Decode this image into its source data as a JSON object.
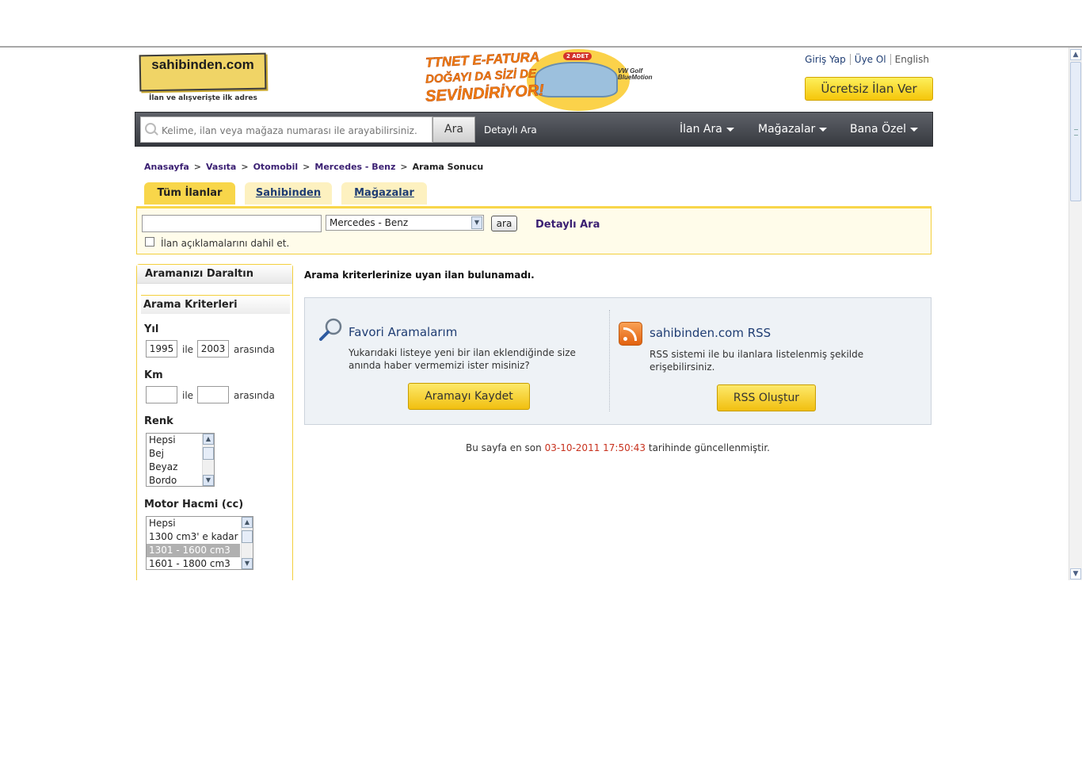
{
  "header": {
    "logo_text": "sahibinden.com",
    "logo_tagline": "İlan ve alışverişte ilk adres",
    "banner": {
      "line1": "TTNET E-FATURA",
      "line2": "DOĞAYI DA SİZİ DE",
      "line3": "SEVİNDİRİYOR!",
      "badge": "2 ADET",
      "model": "VW Golf BlueMotion"
    },
    "links": {
      "login": "Giriş Yap",
      "register": "Üye Ol",
      "english": "English"
    },
    "free_ad_button": "Ücretsiz İlan Ver"
  },
  "navbar": {
    "search_placeholder": "Kelime, ilan veya mağaza numarası ile arayabilirsiniz.",
    "search_button": "Ara",
    "detailed_search": "Detaylı Ara",
    "menus": [
      "İlan Ara",
      "Mağazalar",
      "Bana Özel"
    ]
  },
  "breadcrumb": [
    "Anasayfa",
    "Vasıta",
    "Otomobil",
    "Mercedes - Benz",
    "Arama Sonucu"
  ],
  "tabs": [
    "Tüm İlanlar",
    "Sahibinden",
    "Mağazalar"
  ],
  "filter": {
    "keyword_value": "",
    "brand_selected": "Mercedes - Benz",
    "search_button": "ara",
    "detailed_link": "Detaylı Ara",
    "include_desc_label": "İlan açıklamalarını dahil et."
  },
  "sidebar": {
    "title": "Aramanızı Daraltın",
    "criteria_title": "Arama Kriterleri",
    "year": {
      "label": "Yıl",
      "from": "1995",
      "between": "ile",
      "to": "2003",
      "suffix": "arasında"
    },
    "km": {
      "label": "Km",
      "from": "",
      "between": "ile",
      "to": "",
      "suffix": "arasında"
    },
    "color": {
      "label": "Renk",
      "options": [
        "Hepsi",
        "Bej",
        "Beyaz",
        "Bordo"
      ]
    },
    "engine": {
      "label": "Motor Hacmi (cc)",
      "options": [
        "Hepsi",
        "1300 cm3' e kadar",
        "1301 - 1600 cm3",
        "1601 - 1800 cm3"
      ],
      "selected_index": 2
    }
  },
  "main": {
    "no_result": "Arama kriterlerinize uyan ilan bulunamadı.",
    "favorites": {
      "title": "Favori Aramalarım",
      "desc": "Yukarıdaki listeye yeni bir ilan eklendiğinde size anında haber vermemizi ister misiniz?",
      "button": "Aramayı Kaydet"
    },
    "rss": {
      "title": "sahibinden.com RSS",
      "desc": "RSS sistemi ile bu ilanlara listelenmiş şekilde erişebilirsiniz.",
      "button": "RSS Oluştur"
    },
    "updated_prefix": "Bu sayfa en son",
    "updated_datetime": "03-10-2011 17:50:43",
    "updated_suffix": "tarihinde güncellenmiştir."
  }
}
